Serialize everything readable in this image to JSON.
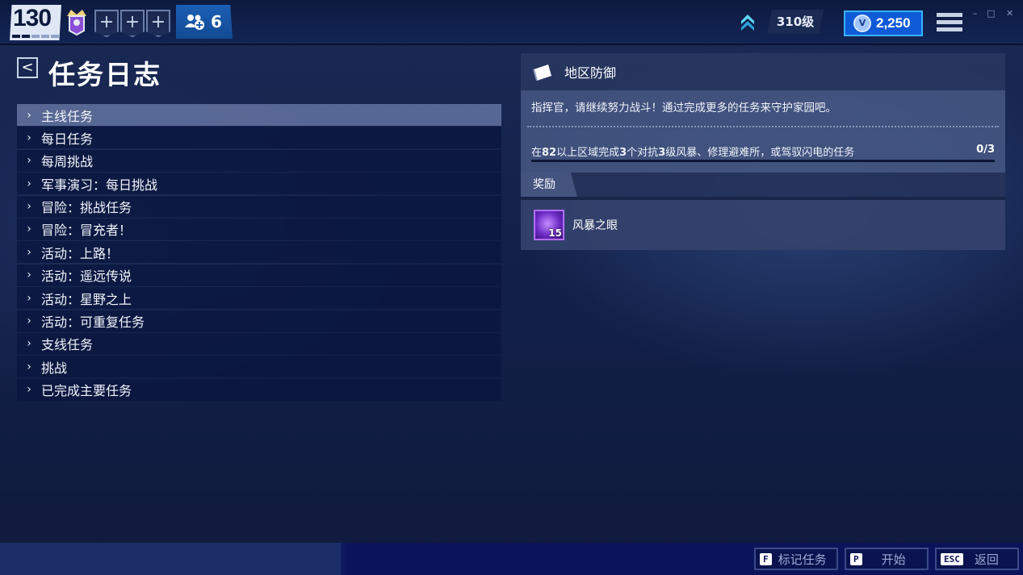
{
  "topbar": {
    "season_level": "130",
    "friends_count": "6",
    "account_level": "310级",
    "vbucks_symbol": "V",
    "vbucks": "2,250",
    "party_slot_symbol": "+",
    "window_controls": [
      "–",
      "□",
      "✕"
    ]
  },
  "page": {
    "back_symbol": "<",
    "title": "任务日志"
  },
  "quest_categories": [
    {
      "label": "主线任务",
      "active": true
    },
    {
      "label": "每日任务"
    },
    {
      "label": "每周挑战"
    },
    {
      "label": "军事演习：每日挑战"
    },
    {
      "label": "冒险：挑战任务"
    },
    {
      "label": "冒险：冒充者！"
    },
    {
      "label": "活动：上路！"
    },
    {
      "label": "活动：遥远传说"
    },
    {
      "label": "活动：星野之上"
    },
    {
      "label": "活动：可重复任务"
    },
    {
      "label": "支线任务"
    },
    {
      "label": "挑战"
    },
    {
      "label": "已完成主要任务"
    }
  ],
  "quest_detail": {
    "title": "地区防御",
    "description": "指挥官，请继续努力战斗！通过完成更多的任务来守护家园吧。",
    "objective": {
      "prefix": "在",
      "level": "82",
      "mid1": "以上区域完成",
      "count": "3",
      "mid2": "个对抗",
      "storm_level": "3",
      "suffix": "级风暴、修理避难所，或驾驭闪电的任务",
      "progress": "0/3"
    },
    "rewards_label": "奖励",
    "reward": {
      "name": "风暴之眼",
      "count": "15"
    }
  },
  "hints": [
    {
      "key": "F",
      "label": "标记任务"
    },
    {
      "key": "P",
      "label": "开始"
    },
    {
      "key": "ESC",
      "label": "返回"
    }
  ]
}
